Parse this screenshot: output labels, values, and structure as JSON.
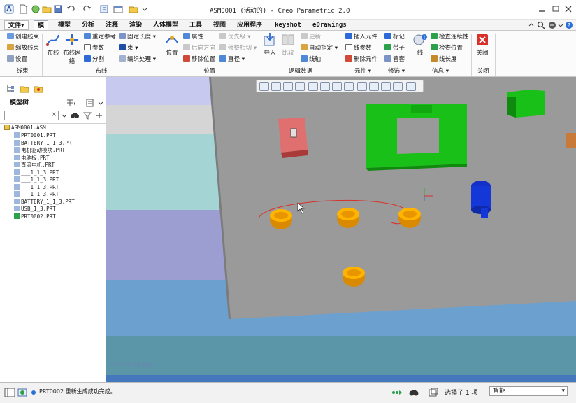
{
  "window": {
    "title": "ASM0001 (活动的) - Creo Parametric 2.0"
  },
  "tabs": [
    {
      "label": "文件",
      "suffix": "▾"
    },
    {
      "label": "模"
    },
    {
      "label": "模型"
    },
    {
      "label": "分析"
    },
    {
      "label": "注释"
    },
    {
      "label": "渲染"
    },
    {
      "label": "人体模型"
    },
    {
      "label": "工具"
    },
    {
      "label": "视图"
    },
    {
      "label": "应用程序"
    },
    {
      "label": "keyshot"
    },
    {
      "label": "eDrawings"
    }
  ],
  "ribbon": {
    "groups": {
      "harness": "线束",
      "routing": "布线",
      "location": "位置",
      "logic": "逻辑数据",
      "components": "元件",
      "decoration": "修饰",
      "info": "信息",
      "close": "关闭"
    },
    "harness_items": [
      "创建线束",
      "缩放线束",
      "设置"
    ],
    "route_big": [
      "布线",
      "布线网络"
    ],
    "route_items": [
      "重定参考",
      "参数",
      "分割"
    ],
    "route_items2": [
      "固定长度",
      "束",
      "编织处理"
    ],
    "location_big": "位置",
    "location_items": [
      "属性",
      "后向方向",
      "移除位置"
    ],
    "location_items2": [
      "优先级",
      "修整相切",
      "直径"
    ],
    "logic_big": [
      "导入",
      "比较"
    ],
    "logic_items": [
      "更新",
      "自动指定",
      "线轴"
    ],
    "component_items": [
      "插入元件",
      "线参数",
      "删除元件"
    ],
    "decoration_items": [
      "标记",
      "带子",
      "管套"
    ],
    "info_big": "线",
    "info_items": [
      "检查连续性",
      "检查位置",
      "线长度"
    ],
    "close_label": "关闭"
  },
  "model_tree": {
    "tab_label": "模型树",
    "search_placeholder": "",
    "items": [
      "ASM0001.ASM",
      "PRT0001.PRT",
      "BATTERY_1_1_3.PRT",
      "电机驱动模块.PRT",
      "电池板.PRT",
      "直流电机.PRT",
      "___1_1_3.PRT",
      "___1_1_3.PRT",
      "___1_1_3.PRT",
      "___1_1_3.PRT",
      "BATTERY_1_1_3.PRT",
      "USB_1_3.PRT",
      "PRT0002.PRT"
    ]
  },
  "viewport": {
    "watermark": "工作区/(设 PRJCO0)"
  },
  "status": {
    "message": "PRT0002 重新生成成功完成。",
    "selection": "选择了 1 项",
    "filter": "智能"
  },
  "colors": {
    "accent_green": "#18c018",
    "accent_blue": "#2a6fd6",
    "orange_part": "#f0a800",
    "plate": "#9a9a9a"
  }
}
